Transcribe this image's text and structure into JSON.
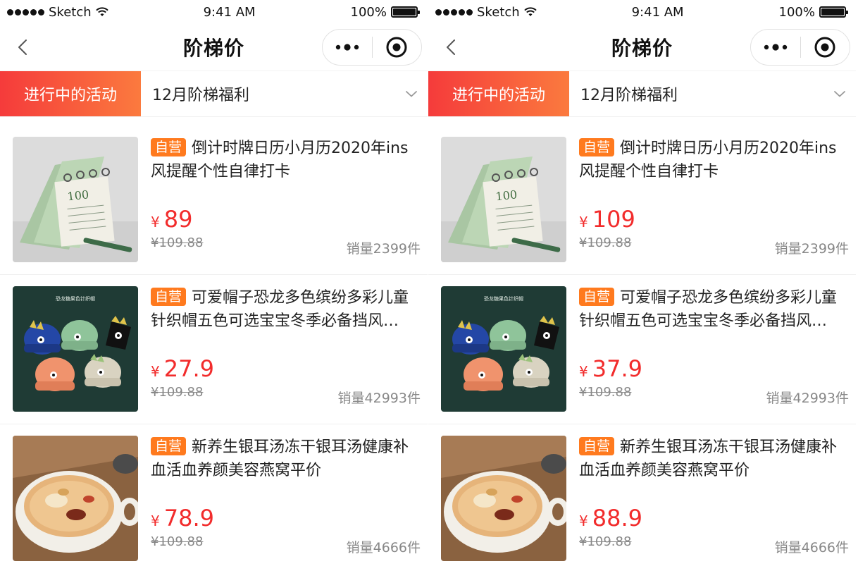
{
  "status_bar": {
    "carrier": "Sketch",
    "time": "9:41 AM",
    "battery": "100%"
  },
  "nav": {
    "title": "阶梯价",
    "back_icon": "chevron-left-icon",
    "more_icon": "more-dots-icon",
    "target_icon": "target-icon"
  },
  "filter": {
    "active_tab": "进行中的活动",
    "dropdown_value": "12月阶梯福利",
    "dropdown_icon": "chevron-down-icon"
  },
  "colors": {
    "accent_start": "#f53b3b",
    "accent_end": "#fb7a3e",
    "price": "#f22c2c",
    "badge": "#ff7a1e"
  },
  "screens": [
    {
      "items": [
        {
          "badge": "自营",
          "title": "倒计时牌日历小月历2020年ins风提醒个性自律打卡",
          "currency": "¥",
          "price": "89",
          "original_price": "¥109.88",
          "sales": "销量2399件",
          "image": "calendar-photo"
        },
        {
          "badge": "自营",
          "title": "可爱帽子恐龙多色缤纷多彩儿童针织帽五色可选宝宝冬季必备挡风…",
          "currency": "¥",
          "price": "27.9",
          "original_price": "¥109.88",
          "sales": "销量42993件",
          "image": "dinosaur-hats-photo",
          "image_caption": "恐龙糖果色针织帽"
        },
        {
          "badge": "自营",
          "title": "新养生银耳汤冻干银耳汤健康补血活血养颜美容燕窝平价",
          "currency": "¥",
          "price": "78.9",
          "original_price": "¥109.88",
          "sales": "销量4666件",
          "image": "soup-bowl-photo"
        }
      ]
    },
    {
      "items": [
        {
          "badge": "自营",
          "title": "倒计时牌日历小月历2020年ins风提醒个性自律打卡",
          "currency": "¥",
          "price": "109",
          "original_price": "¥109.88",
          "sales": "销量2399件",
          "image": "calendar-photo"
        },
        {
          "badge": "自营",
          "title": "可爱帽子恐龙多色缤纷多彩儿童针织帽五色可选宝宝冬季必备挡风…",
          "currency": "¥",
          "price": "37.9",
          "original_price": "¥109.88",
          "sales": "销量42993件",
          "image": "dinosaur-hats-photo",
          "image_caption": "恐龙糖果色针织帽"
        },
        {
          "badge": "自营",
          "title": "新养生银耳汤冻干银耳汤健康补血活血养颜美容燕窝平价",
          "currency": "¥",
          "price": "88.9",
          "original_price": "¥109.88",
          "sales": "销量4666件",
          "image": "soup-bowl-photo"
        }
      ]
    }
  ]
}
